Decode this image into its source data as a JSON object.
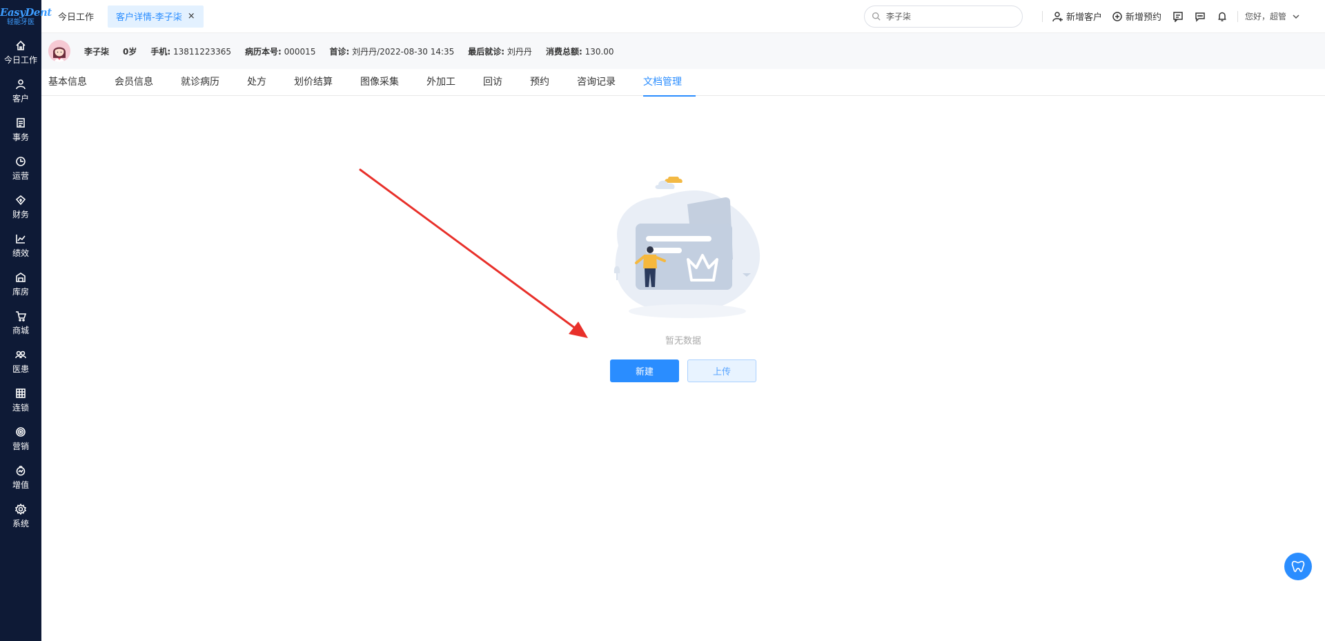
{
  "sidebar": {
    "logo": "EasyDent",
    "logo_sub": "轻能牙医",
    "items": [
      {
        "label": "今日工作",
        "icon": "home-icon"
      },
      {
        "label": "客户",
        "icon": "user-icon"
      },
      {
        "label": "事务",
        "icon": "document-icon"
      },
      {
        "label": "运营",
        "icon": "clock-icon"
      },
      {
        "label": "财务",
        "icon": "finance-icon"
      },
      {
        "label": "绩效",
        "icon": "chart-icon"
      },
      {
        "label": "库房",
        "icon": "warehouse-icon"
      },
      {
        "label": "商城",
        "icon": "cart-icon"
      },
      {
        "label": "医患",
        "icon": "people-icon"
      },
      {
        "label": "连锁",
        "icon": "building-icon"
      },
      {
        "label": "营销",
        "icon": "target-icon"
      },
      {
        "label": "增值",
        "icon": "growth-icon"
      },
      {
        "label": "系统",
        "icon": "settings-icon"
      }
    ]
  },
  "topbar": {
    "tabs": [
      {
        "label": "今日工作"
      },
      {
        "label": "客户详情-李子柒"
      }
    ],
    "close": "×",
    "search_value": "李子柒",
    "new_customer": "新增客户",
    "new_appointment": "新增预约",
    "greeting": "您好，超管"
  },
  "patient": {
    "name": "李子柒",
    "age": "0岁",
    "phone_label": "手机:",
    "phone": "13811223365",
    "record_label": "病历本号:",
    "record": "000015",
    "first_label": "首诊:",
    "first": "刘丹丹/2022-08-30 14:35",
    "last_label": "最后就诊:",
    "last": "刘丹丹",
    "total_label": "消费总额:",
    "total": "130.00"
  },
  "subtabs": [
    {
      "label": "基本信息"
    },
    {
      "label": "会员信息"
    },
    {
      "label": "就诊病历"
    },
    {
      "label": "处方"
    },
    {
      "label": "划价结算"
    },
    {
      "label": "图像采集"
    },
    {
      "label": "外加工"
    },
    {
      "label": "回访"
    },
    {
      "label": "预约"
    },
    {
      "label": "咨询记录"
    },
    {
      "label": "文档管理"
    }
  ],
  "active_subtab": "文档管理",
  "empty": {
    "text": "暂无数据",
    "new_button": "新建",
    "upload_button": "上传"
  },
  "colors": {
    "sidebar_bg": "#0e1a36",
    "accent": "#2a8dff",
    "annotation_arrow": "#e8302a"
  }
}
